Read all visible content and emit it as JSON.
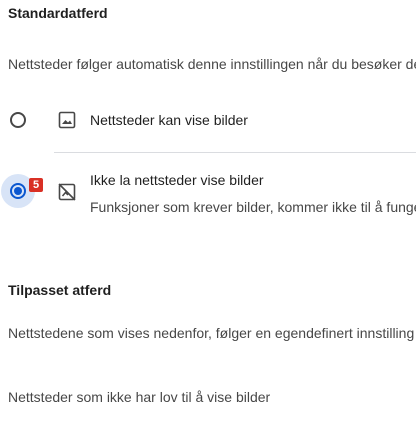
{
  "default_behavior": {
    "heading": "Standardatferd",
    "description": "Nettsteder følger automatisk denne innstillingen når du besøker dem",
    "options": [
      {
        "label": "Nettsteder kan vise bilder",
        "icon": "image-icon",
        "selected": false
      },
      {
        "label": "Ikke la nettsteder vise bilder",
        "sublabel": "Funksjoner som krever bilder, kommer ikke til å fungere",
        "icon": "image-off-icon",
        "selected": true,
        "badge": "5"
      }
    ]
  },
  "custom_behavior": {
    "heading": "Tilpasset atferd",
    "description": "Nettstedene som vises nedenfor, følger en egendefinert innstilling",
    "not_allowed_heading": "Nettsteder som ikke har lov til å vise bilder"
  },
  "colors": {
    "accent": "#0b57d0",
    "badge": "#d93025"
  }
}
